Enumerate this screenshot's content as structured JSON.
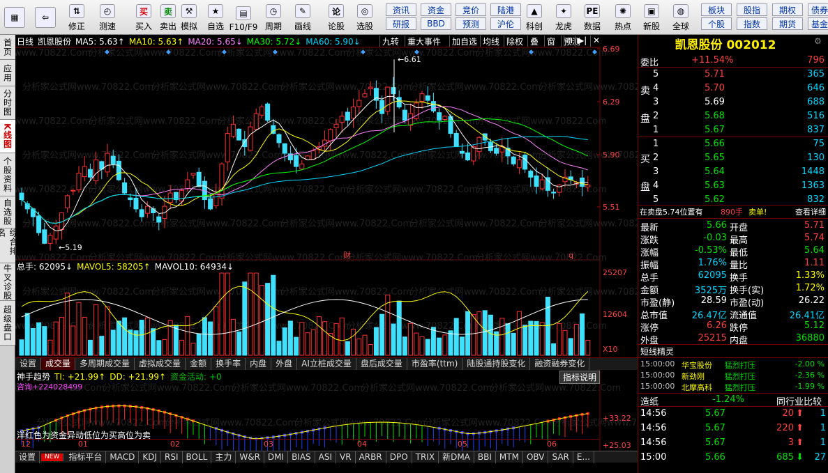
{
  "toolbar": {
    "items": [
      {
        "label": "",
        "icon": "logo-icon"
      },
      {
        "label": "",
        "icon": "back-icon"
      },
      {
        "label": "修正",
        "icon": "updown-icon"
      },
      {
        "label": "测速",
        "icon": "speed-icon"
      },
      {
        "label": "买入",
        "icon": "buy-icon",
        "glyph": "买"
      },
      {
        "label": "卖出",
        "icon": "sell-icon",
        "glyph": "卖"
      },
      {
        "label": "模拟",
        "icon": "hammer-icon"
      },
      {
        "label": "自选",
        "icon": "star-icon"
      },
      {
        "label": "F10/F9",
        "icon": "f10-icon"
      },
      {
        "label": "周期",
        "icon": "clock-icon"
      },
      {
        "label": "画线",
        "icon": "pen-icon"
      },
      {
        "label": "论股",
        "icon": "discuss-icon"
      },
      {
        "label": "选股",
        "icon": "select-icon"
      }
    ],
    "small_left": [
      [
        "资讯",
        "资金",
        "竞价",
        "陆港"
      ],
      [
        "研报",
        "BBD",
        "预测",
        "沪伦"
      ]
    ],
    "icons2": [
      {
        "label": "科创",
        "icon": "kechuang-icon"
      },
      {
        "label": "龙虎",
        "icon": "dragon-icon"
      },
      {
        "label": "数据",
        "icon": "data-icon",
        "glyph": "PE"
      },
      {
        "label": "热点",
        "icon": "hot-icon"
      },
      {
        "label": "新股",
        "icon": "newstock-icon"
      },
      {
        "label": "全球",
        "icon": "globe-icon"
      }
    ],
    "small_right": [
      [
        "板块",
        "股指",
        "期权",
        "债券"
      ],
      [
        "个股",
        "指数",
        "期货",
        "基金"
      ]
    ]
  },
  "leftnav": [
    "首页",
    "应用",
    "分时图",
    "K线图",
    "个股资料",
    "自选股",
    "综合排名",
    "牛叉诊股",
    "超级盘口"
  ],
  "leftnav_active": 3,
  "kline": {
    "header": [
      {
        "t": "日线",
        "c": "#ffffff"
      },
      {
        "t": "凯恩股份",
        "c": "#ffffff"
      },
      {
        "t": "MA5: 5.63↑",
        "c": "#ffffff"
      },
      {
        "t": "MA10: 5.63↑",
        "c": "#ffff00"
      },
      {
        "t": "MA20: 5.65↓",
        "c": "#ff80ff"
      },
      {
        "t": "MA30: 5.72↓",
        "c": "#00ff00"
      },
      {
        "t": "MA60: 5.90↓",
        "c": "#00d8ff"
      }
    ],
    "buttons": [
      "九转",
      "重大事件",
      "加自选",
      "均线",
      "除权",
      "叠",
      "窗",
      "预测"
    ],
    "ylabels": [
      "6.69",
      "6.29",
      "5.90",
      "5.51"
    ],
    "high_label": "6.61",
    "low_label": "5.19",
    "marker_cai": "财",
    "marker_q": "q",
    "x_months": [
      "12",
      "01",
      "02",
      "03",
      "04",
      "05",
      "06"
    ]
  },
  "volume": {
    "header": [
      {
        "t": "总手: 62095↓",
        "c": "#ffffff"
      },
      {
        "t": "MAVOL5: 58205↑",
        "c": "#ffff00"
      },
      {
        "t": "MAVOL10: 64934↓",
        "c": "#ffffff"
      }
    ],
    "ylabels": [
      "25207",
      "12604",
      "X10"
    ]
  },
  "tabs": [
    "设置",
    "成交量",
    "多周期成交量",
    "虚拟成交量",
    "金额",
    "换手率",
    "内盘",
    "外盘",
    "AI立桩成交量",
    "盘后成交量",
    "市盈率(ttm)",
    "陆股通持股变化",
    "融资融券变化"
  ],
  "indicator": {
    "header": [
      {
        "t": "神手趋势",
        "c": "#ffffff"
      },
      {
        "t": "TI: +21.99↑",
        "c": "#ffff00"
      },
      {
        "t": "DD: +21.99↑",
        "c": "#ffff00"
      },
      {
        "t": "资金活动: +0",
        "c": "#00c000"
      }
    ],
    "sub": "咨询+224028499",
    "note": "洋红色为资金异动低位为买高位为卖",
    "button": "指标说明",
    "ylabels": [
      "+33.22",
      "+25.03"
    ]
  },
  "bottom_tabs": [
    "设置",
    "NEW",
    "指标平台",
    "MACD",
    "KDJ",
    "RSI",
    "BOLL",
    "主力",
    "W&R",
    "DMI",
    "BIAS",
    "ASI",
    "VR",
    "ARBR",
    "DPO",
    "TRIX",
    "新DMA",
    "BBI",
    "MTM",
    "OBV",
    "SAR",
    "E..."
  ],
  "watermark": "分析家公式网www.70822.Com",
  "stock": {
    "name": "凯恩股份",
    "code": "002012"
  },
  "weibi": {
    "label": "委比",
    "pct": "+11.54%",
    "val": "796"
  },
  "sell": [
    {
      "n": "5",
      "p": "5.71",
      "v": "365",
      "pc": "red"
    },
    {
      "n": "4",
      "p": "5.70",
      "v": "646",
      "pc": "red"
    },
    {
      "n": "3",
      "p": "5.69",
      "v": "688",
      "pc": "wht"
    },
    {
      "n": "2",
      "p": "5.68",
      "v": "516",
      "pc": "green"
    },
    {
      "n": "1",
      "p": "5.67",
      "v": "837",
      "pc": "green"
    }
  ],
  "buy": [
    {
      "n": "1",
      "p": "5.66",
      "v": "75"
    },
    {
      "n": "2",
      "p": "5.65",
      "v": "130"
    },
    {
      "n": "3",
      "p": "5.64",
      "v": "1448"
    },
    {
      "n": "4",
      "p": "5.63",
      "v": "1363"
    },
    {
      "n": "5",
      "p": "5.62",
      "v": "832"
    }
  ],
  "sell_label": [
    "卖",
    "盘"
  ],
  "buy_label": [
    "买",
    "盘"
  ],
  "notice": {
    "text": "在卖盘5.74位置有",
    "qty": "890手",
    "act": "卖单!",
    "link": "查看详细"
  },
  "quote": [
    {
      "l": "最新",
      "v": "5.66",
      "vc": "green",
      "l2": "开盘",
      "v2": "5.71",
      "vc2": "red"
    },
    {
      "l": "涨跌",
      "v": "-0.03",
      "vc": "green",
      "l2": "最高",
      "v2": "5.74",
      "vc2": "red"
    },
    {
      "l": "涨幅",
      "v": "-0.53%",
      "vc": "green",
      "l2": "最低",
      "v2": "5.64",
      "vc2": "green"
    },
    {
      "l": "振幅",
      "v": "1.76%",
      "vc": "cyan",
      "l2": "量比",
      "v2": "1.11",
      "vc2": "red"
    },
    {
      "l": "总手",
      "v": "62095",
      "vc": "cyan",
      "l2": "换手",
      "v2": "1.33%",
      "vc2": "yel"
    },
    {
      "l": "金额",
      "v": "3525万",
      "vc": "cyan",
      "l2": "换手(实)",
      "v2": "1.72%",
      "vc2": "yel"
    },
    {
      "l": "市盈(静)",
      "v": "28.59",
      "vc": "wht",
      "l2": "市盈(动)",
      "v2": "26.22",
      "vc2": "wht"
    },
    {
      "l": "总市值",
      "v": "26.47亿",
      "vc": "cyan",
      "l2": "流通值",
      "v2": "26.41亿",
      "vc2": "cyan"
    },
    {
      "l": "涨停",
      "v": "6.26",
      "vc": "red",
      "l2": "跌停",
      "v2": "5.12",
      "vc2": "green"
    },
    {
      "l": "外盘",
      "v": "25215",
      "vc": "red",
      "l2": "内盘",
      "v2": "36880",
      "vc2": "green"
    }
  ],
  "sprite": {
    "title": "短线精灵",
    "rows": [
      {
        "t": "15:00:00",
        "n": "华宝股份",
        "a": "猛烈打压",
        "p": "-2.00 %"
      },
      {
        "t": "15:00:00",
        "n": "新劲刚",
        "a": "猛烈打压",
        "p": "-2.36 %"
      },
      {
        "t": "15:00:00",
        "n": "北摩高科",
        "a": "猛烈打压",
        "p": "-1.99 %"
      }
    ]
  },
  "sector": {
    "name": "造纸",
    "pct": "-1.24%",
    "btn": "同行业比较"
  },
  "ticks": [
    {
      "t": "14:56",
      "p": "5.67",
      "v": "20",
      "dir": "up",
      "n": "1",
      "vc": "red"
    },
    {
      "t": "14:56",
      "p": "5.67",
      "v": "220",
      "dir": "up",
      "n": "1",
      "vc": "red"
    },
    {
      "t": "14:56",
      "p": "5.67",
      "v": "3",
      "dir": "up",
      "n": "1",
      "vc": "red"
    },
    {
      "t": "15:00",
      "p": "5.66",
      "v": "685",
      "dir": "down",
      "n": "27",
      "vc": "green"
    }
  ],
  "chart_data": {
    "type": "candlestick",
    "ylim": [
      5.19,
      6.69
    ],
    "close": [
      5.55,
      5.48,
      5.42,
      5.3,
      5.22,
      5.28,
      5.35,
      5.45,
      5.58,
      5.62,
      5.75,
      5.8,
      5.72,
      5.85,
      5.78,
      5.9,
      5.82,
      5.7,
      5.6,
      5.55,
      5.48,
      5.42,
      5.5,
      5.45,
      5.38,
      5.5,
      5.6,
      5.55,
      5.62,
      5.7,
      5.75,
      5.65,
      5.55,
      5.48,
      5.6,
      5.82,
      6.05,
      6.12,
      6.0,
      5.95,
      6.1,
      6.2,
      6.25,
      6.15,
      6.05,
      5.98,
      5.9,
      5.85,
      5.8,
      5.82,
      5.88,
      5.92,
      5.95,
      6.0,
      6.08,
      6.12,
      6.18,
      6.15,
      6.25,
      6.3,
      6.35,
      6.4,
      6.3,
      6.2,
      6.4,
      6.35,
      6.25,
      6.15,
      6.2,
      6.28,
      6.35,
      6.3,
      6.22,
      6.15,
      6.18,
      6.05,
      5.95,
      5.9,
      5.85,
      5.95,
      6.02,
      6.0,
      5.92,
      5.9,
      5.95,
      5.88,
      5.82,
      5.85,
      5.78,
      5.72,
      5.65,
      5.7,
      5.62,
      5.6,
      5.66,
      5.72,
      5.7,
      5.68,
      5.65,
      5.66
    ]
  }
}
